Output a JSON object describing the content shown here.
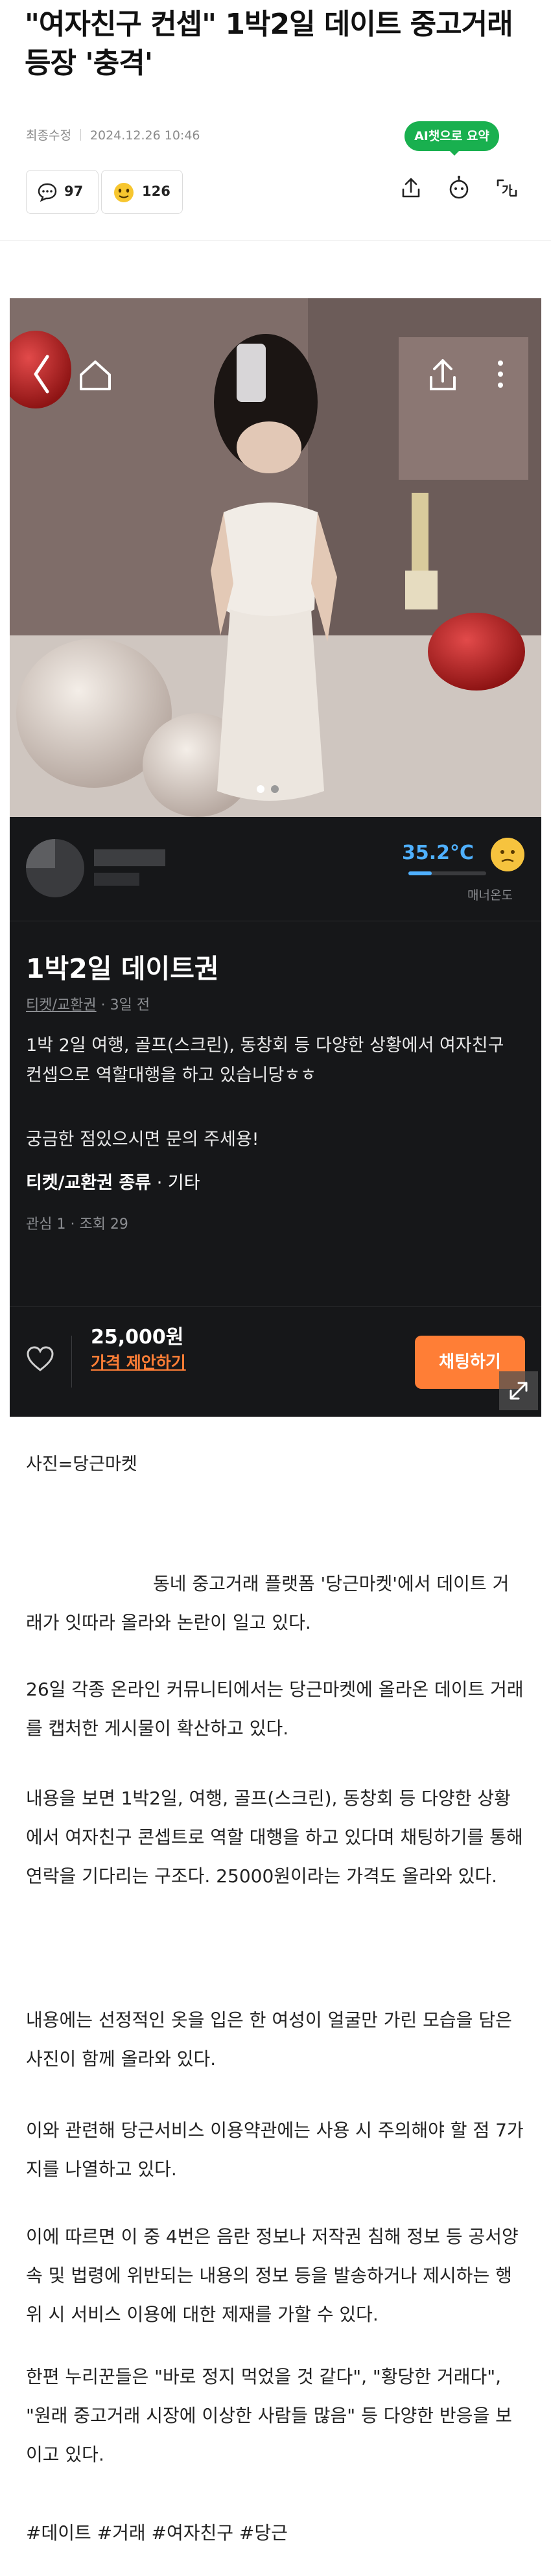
{
  "article": {
    "headline": "\"여자친구 컨셉\" 1박2일 데이트 중고거래 등장 '충격'",
    "meta_label": "최종수정",
    "date": "2024.12.26 10:46",
    "ai_summary": "AI챗으로 요약",
    "comments_count": "97",
    "reactions_count": "126",
    "icons": [
      "comment-icon",
      "reaction-emoji-icon",
      "share-icon",
      "robot-icon",
      "font-size-icon"
    ]
  },
  "listing": {
    "temperature": "35.2°C",
    "manner_label": "매너온도",
    "title": "1박2일 데이트권",
    "category": "티켓/교환권",
    "posted": "3일 전",
    "description": "1박 2일 여행, 골프(스크린), 동창회 등 다양한 상황에서 여자친구 컨셉으로 역할대행을 하고 있습니당ㅎㅎ",
    "question": "궁금한 점있으시면 문의 주세용!",
    "type_label": "티켓/교환권 종류",
    "type_value": "기타",
    "stats": "관심 1 · 조회 29",
    "price": "25,000원",
    "offer_link": "가격 제안하기",
    "chat_button": "채팅하기",
    "accent_color": "#ff7e36"
  },
  "caption": "사진=당근마켓",
  "paragraphs": [
    "동네 중고거래 플랫폼 '당근마켓'에서 데이트 거래가 잇따라 올라와 논란이 일고 있다.",
    "26일 각종 온라인 커뮤니티에서는 당근마켓에 올라온 데이트 거래를 캡처한 게시물이 확산하고 있다.",
    "내용을 보면 1박2일, 여행, 골프(스크린), 동창회 등 다양한 상황에서 여자친구 콘셉트로 역할 대행을 하고 있다며 채팅하기를 통해 연락을 기다리는 구조다. 25000원이라는 가격도 올라와 있다.",
    "내용에는 선정적인 옷을 입은 한 여성이 얼굴만 가린 모습을 담은 사진이 함께 올라와 있다.",
    "이와 관련해 당근서비스 이용약관에는 사용 시 주의해야 할 점 7가지를 나열하고 있다.",
    "이에 따르면 이 중 4번은 음란 정보나 저작권 침해 정보 등 공서양속 및 법령에 위반되는 내용의 정보 등을 발송하거나 제시하는 행위 시 서비스 이용에 대한 제재를 가할 수 있다.",
    "한편 누리꾼들은 \"바로 정지 먹었을 것 같다\", \"황당한 거래다\", \"원래 중고거래 시장에 이상한 사람들 많음\" 등 다양한 반응을 보이고 있다."
  ],
  "hashtags": "#데이트 #거래 #여자친구 #당근"
}
